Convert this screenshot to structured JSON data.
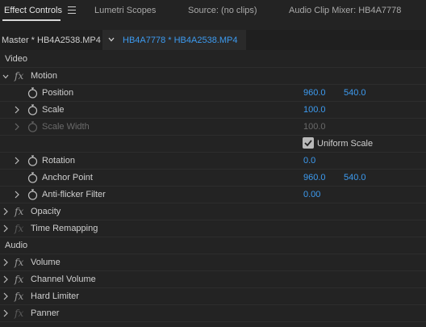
{
  "tabs": [
    {
      "label": "Effect Controls",
      "active": true
    },
    {
      "label": "Lumetri Scopes",
      "active": false
    },
    {
      "label": "Source: (no clips)",
      "active": false
    },
    {
      "label": "Audio Clip Mixer: HB4A7778",
      "active": false
    }
  ],
  "clip_header": {
    "master": "Master * HB4A2538.MP4",
    "active": "HB4A7778 * HB4A2538.MP4"
  },
  "sections": {
    "video": "Video",
    "audio": "Audio"
  },
  "video_effects": {
    "motion": {
      "label": "Motion",
      "position": {
        "label": "Position",
        "x": "960.0",
        "y": "540.0"
      },
      "scale": {
        "label": "Scale",
        "value": "100.0"
      },
      "scale_width": {
        "label": "Scale Width",
        "value": "100.0"
      },
      "uniform_scale": {
        "label": "Uniform Scale",
        "checked": true
      },
      "rotation": {
        "label": "Rotation",
        "value": "0.0"
      },
      "anchor_point": {
        "label": "Anchor Point",
        "x": "960.0",
        "y": "540.0"
      },
      "anti_flicker": {
        "label": "Anti-flicker Filter",
        "value": "0.00"
      }
    },
    "opacity": {
      "label": "Opacity"
    },
    "time_remapping": {
      "label": "Time Remapping"
    }
  },
  "audio_effects": [
    {
      "label": "Volume"
    },
    {
      "label": "Channel Volume"
    },
    {
      "label": "Hard Limiter"
    },
    {
      "label": "Panner"
    }
  ],
  "colors": {
    "accent": "#3d9bf0",
    "background": "#232323"
  },
  "icons": [
    "menu-icon",
    "chevron-down-icon",
    "chevron-right-icon",
    "fx-icon",
    "stopwatch-icon",
    "checkbox-icon"
  ]
}
